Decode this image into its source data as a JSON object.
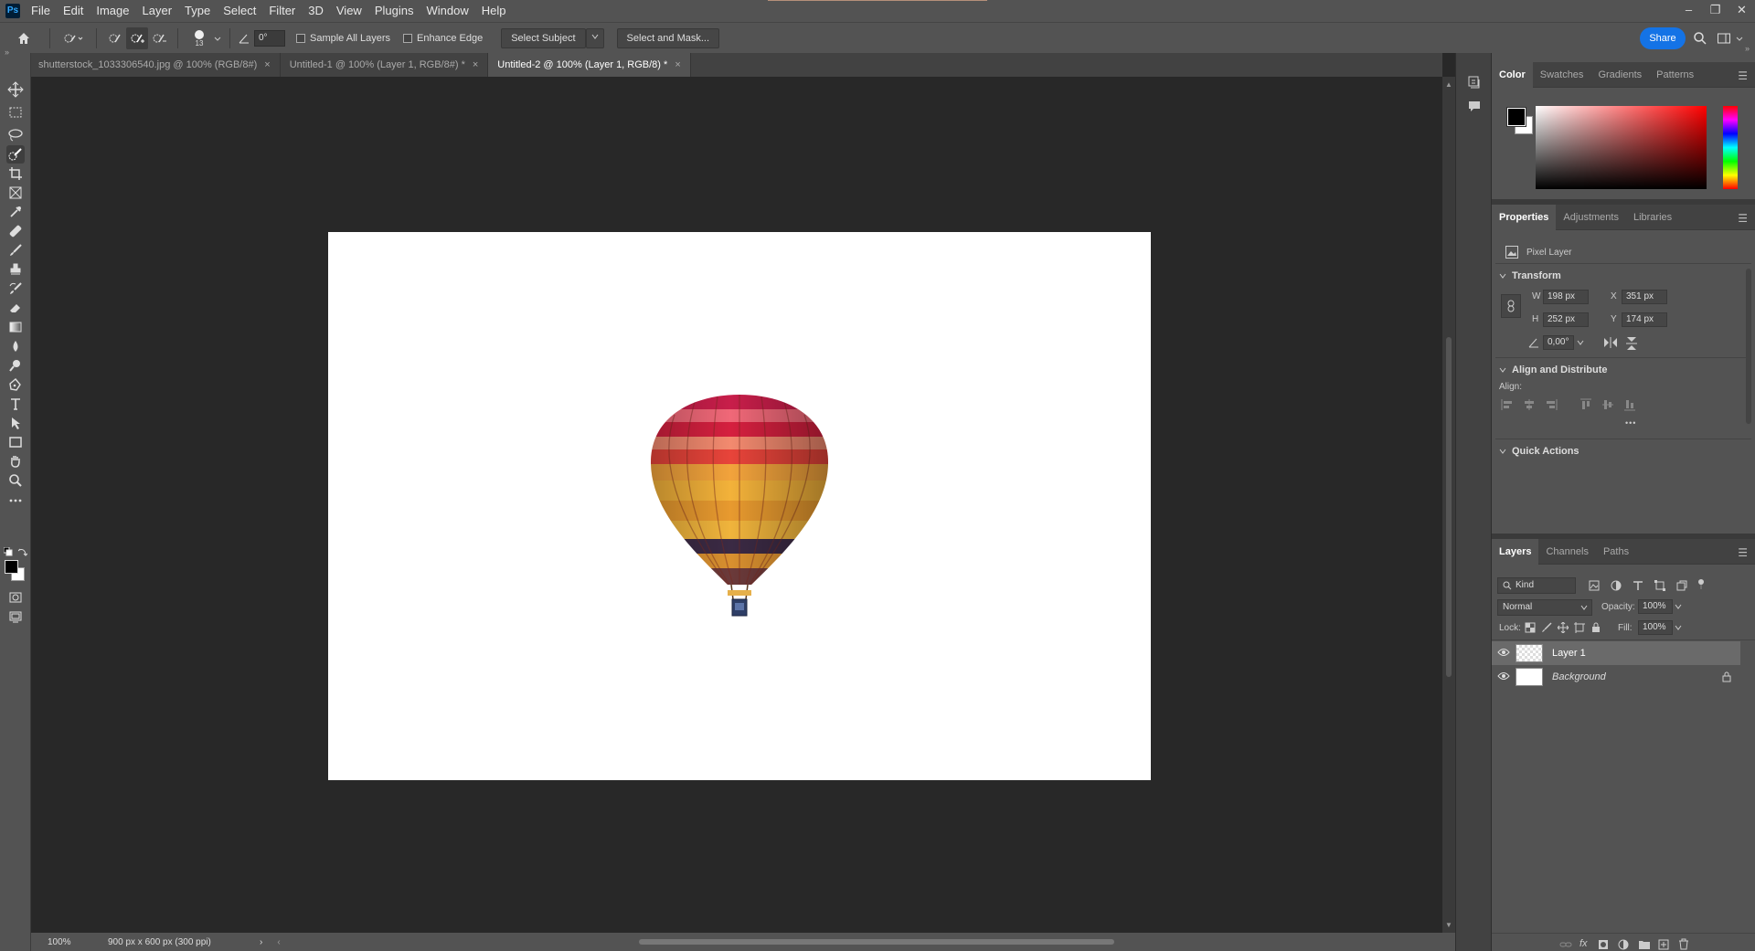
{
  "app": {
    "logo": "Ps"
  },
  "menu": [
    "File",
    "Edit",
    "Image",
    "Layer",
    "Type",
    "Select",
    "Filter",
    "3D",
    "View",
    "Plugins",
    "Window",
    "Help"
  ],
  "window_controls": {
    "minimize": "–",
    "restore": "❐",
    "close": "✕"
  },
  "options": {
    "brush_size": "13",
    "angle": "0°",
    "sample_all_layers": "Sample All Layers",
    "enhance_edge": "Enhance Edge",
    "select_subject": "Select Subject",
    "select_and_mask": "Select and Mask...",
    "share": "Share"
  },
  "tabs": [
    {
      "label": "shutterstock_1033306540.jpg @ 100% (RGB/8#)",
      "close": "×"
    },
    {
      "label": "Untitled-1 @ 100% (Layer 1, RGB/8#) *",
      "close": "×"
    },
    {
      "label": "Untitled-2 @ 100% (Layer 1, RGB/8) *",
      "close": "×"
    }
  ],
  "status": {
    "zoom": "100%",
    "doc_info": "900 px x 600 px (300 ppi)",
    "arrow": "›",
    "arrow_left": "‹"
  },
  "color_panel": {
    "tabs": [
      "Color",
      "Swatches",
      "Gradients",
      "Patterns"
    ],
    "fg": "#000000",
    "bg": "#ffffff"
  },
  "properties": {
    "tabs": [
      "Properties",
      "Adjustments",
      "Libraries"
    ],
    "type": "Pixel Layer",
    "transform_title": "Transform",
    "w_label": "W",
    "w": "198 px",
    "h_label": "H",
    "h": "252 px",
    "x_label": "X",
    "x": "351 px",
    "y_label": "Y",
    "y": "174 px",
    "angle": "0,00°",
    "align_title": "Align and Distribute",
    "align_label": "Align:",
    "more": "•••",
    "quick_actions": "Quick Actions"
  },
  "layers": {
    "tabs": [
      "Layers",
      "Channels",
      "Paths"
    ],
    "filter": "Kind",
    "blend": "Normal",
    "opacity_label": "Opacity:",
    "opacity": "100%",
    "lock_label": "Lock:",
    "fill_label": "Fill:",
    "fill": "100%",
    "items": [
      {
        "name": "Layer 1"
      },
      {
        "name": "Background"
      }
    ]
  }
}
